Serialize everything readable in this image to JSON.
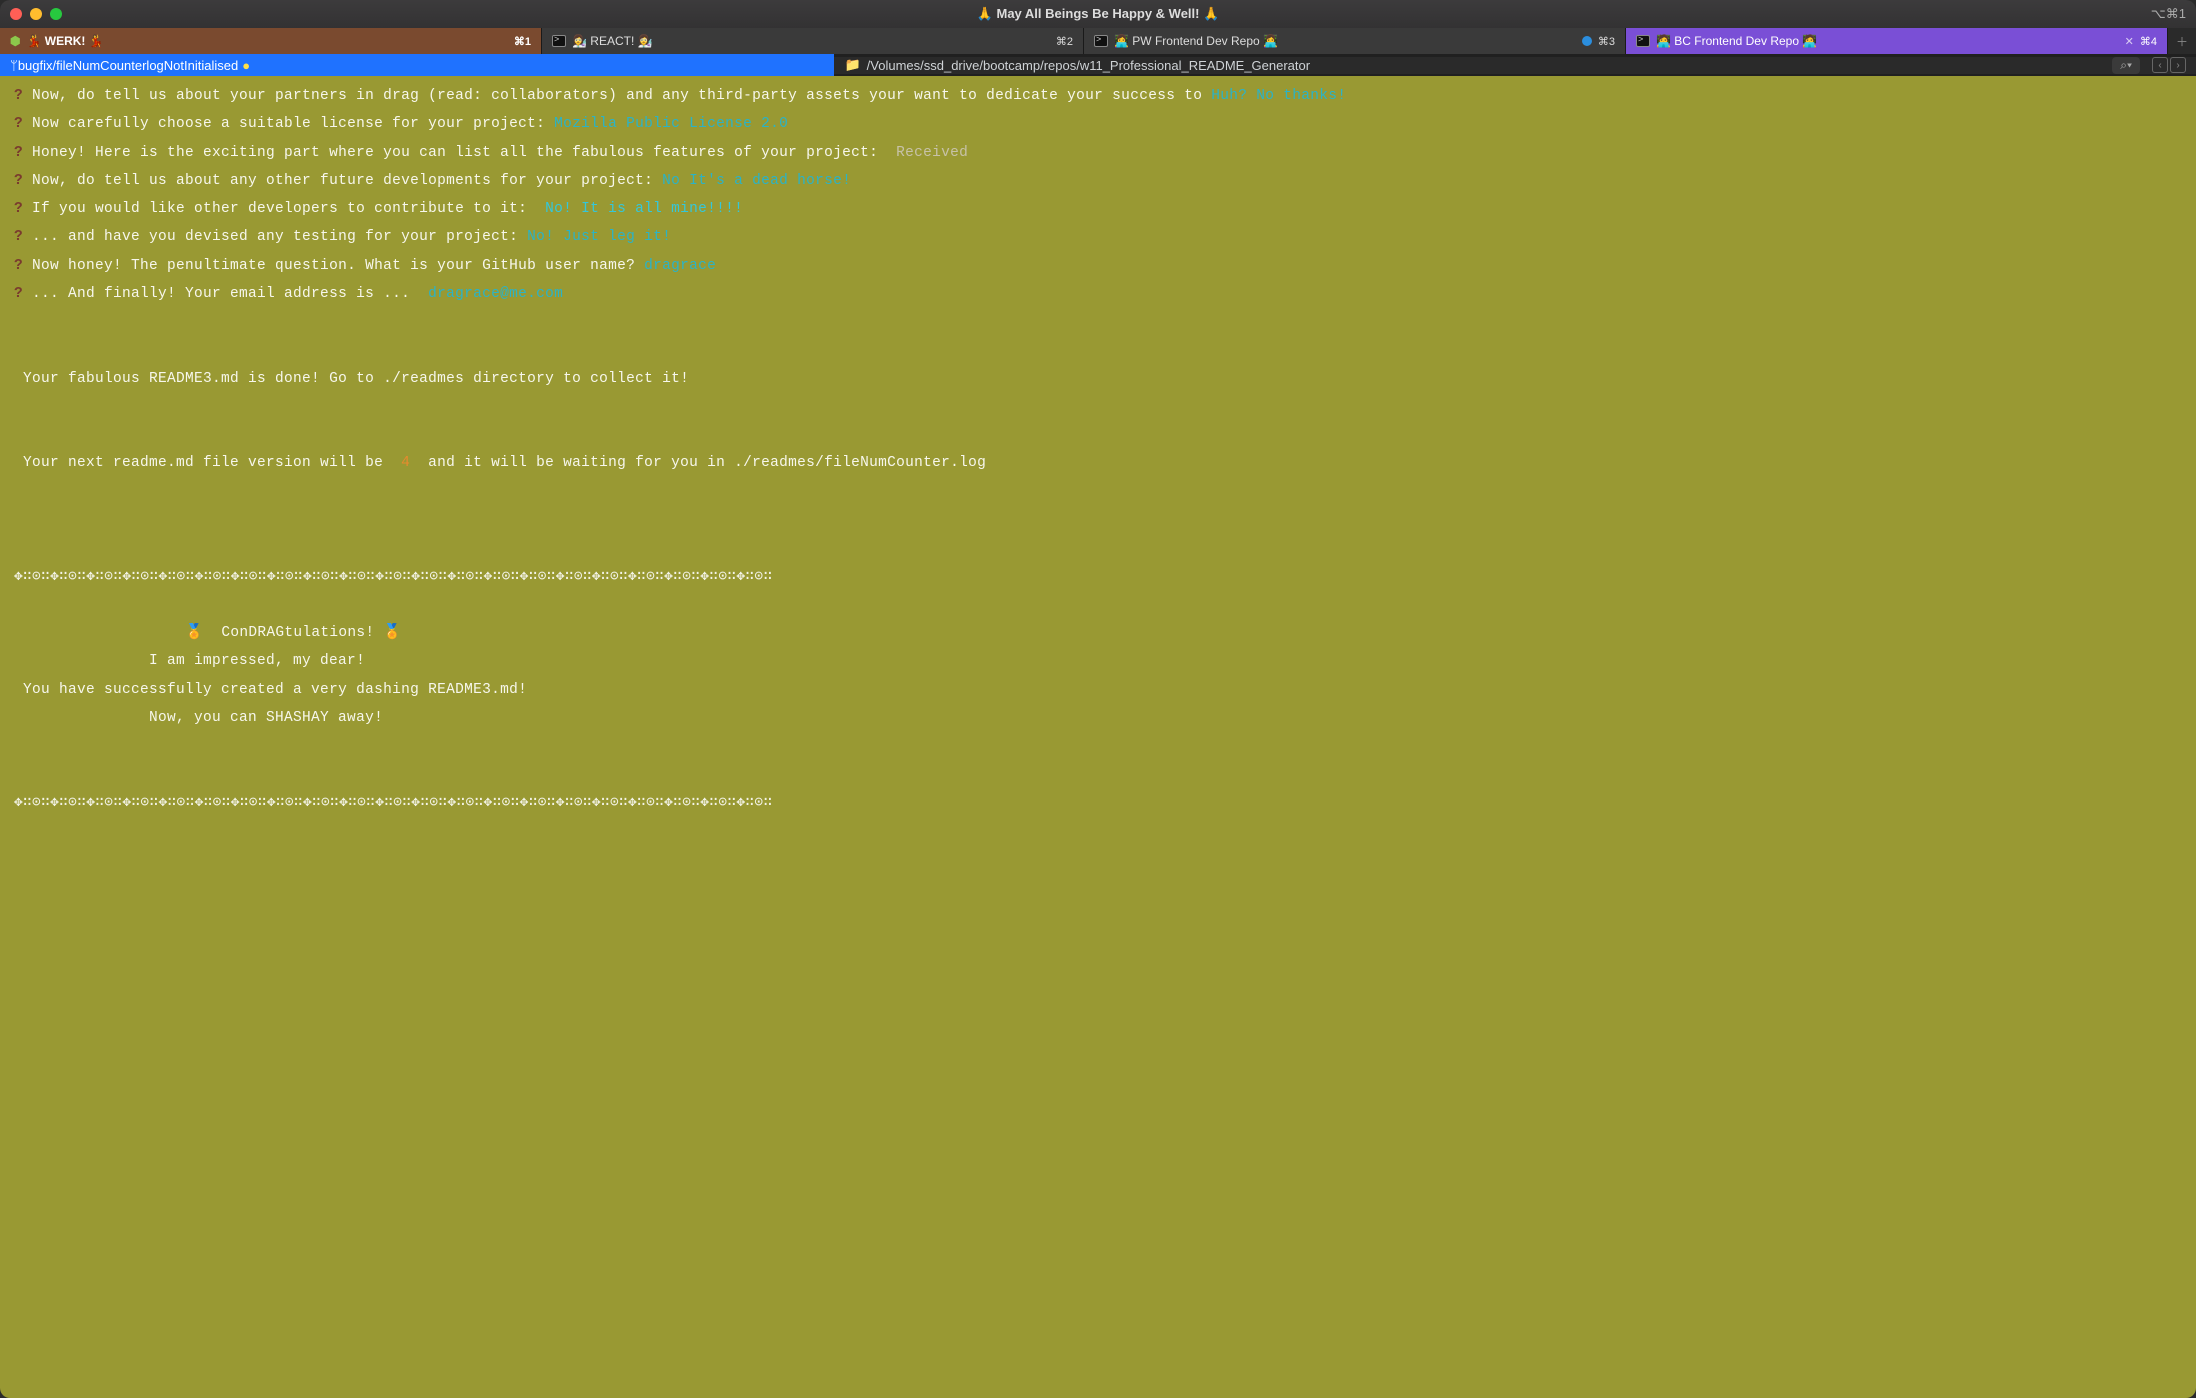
{
  "window": {
    "title": "🙏 May All Beings Be Happy & Well! 🙏",
    "right_shortcut": "⌥⌘1"
  },
  "tabs": [
    {
      "label": "💃 WERK! 💃",
      "shortcut": "⌘1",
      "kind": "active"
    },
    {
      "label": "👩‍🔬 REACT! 👩‍🔬",
      "shortcut": "⌘2",
      "kind": "react"
    },
    {
      "label": "👩‍💻 PW Frontend Dev Repo 👩‍💻",
      "shortcut": "⌘3",
      "kind": "pw"
    },
    {
      "label": "🧑‍💻 BC Frontend Dev Repo 🧑‍💻",
      "shortcut": "⌘4",
      "kind": "bc"
    }
  ],
  "branchbar": {
    "branch_prefix": "ᛘ ",
    "branch": "bugfix/fileNumCounterlogNotInitialised",
    "modified": "●",
    "path_prefix": "📁",
    "path": "/Volumes/ssd_drive/bootcamp/repos/w11_Professional_README_Generator",
    "search_label": "⌕▾"
  },
  "lines": [
    {
      "q": "?",
      "prompt": " Now, do tell us about your partners in drag (read: collaborators) and any third-party assets your want to dedicate your success to ",
      "answer": "Huh? No thanks!"
    },
    {
      "q": "?",
      "prompt": " Now carefully choose a suitable license for your project: ",
      "answer": "Mozilla Public License 2.0"
    },
    {
      "q": "?",
      "prompt": " Honey! Here is the exciting part where you can list all the fabulous features of your project:  ",
      "received": "Received"
    },
    {
      "q": "?",
      "prompt": " Now, do tell us about any other future developments for your project: ",
      "answer": "No It's a dead horse!"
    },
    {
      "q": "?",
      "prompt": " If you would like other developers to contribute to it:  ",
      "answer": "No! It is all mine!!!!"
    },
    {
      "q": "?",
      "prompt": " ... and have you devised any testing for your project: ",
      "answer": "No! Just leg it!"
    },
    {
      "q": "?",
      "prompt": " Now honey! The penultimate question. What is your GitHub user name? ",
      "answer": "dragrace"
    },
    {
      "q": "?",
      "prompt": " ... And finally! Your email address is ...  ",
      "answer": "dragrace@me.com"
    }
  ],
  "output": {
    "done": " Your fabulous README3.md is done! Go to ./readmes directory to collect it!",
    "next_prefix": " Your next readme.md file version will be  ",
    "next_num": "4",
    "next_suffix": "  and it will be waiting for you in ./readmes/fileNumCounter.log",
    "deco": "✥∷⊙∷✥∷⊙∷✥∷⊙∷✥∷⊙∷✥∷⊙∷✥∷⊙∷✥∷⊙∷✥∷⊙∷✥∷⊙∷✥∷⊙∷✥∷⊙∷✥∷⊙∷✥∷⊙∷✥∷⊙∷✥∷⊙∷✥∷⊙∷✥∷⊙∷✥∷⊙∷✥∷⊙∷✥∷⊙∷✥∷⊙∷",
    "c1": "                   🏅  ConDRAGtulations! 🏅",
    "c2": "               I am impressed, my dear!",
    "c3": " You have successfully created a very dashing README3.md!",
    "c4": "               Now, you can SHASHAY away!"
  }
}
